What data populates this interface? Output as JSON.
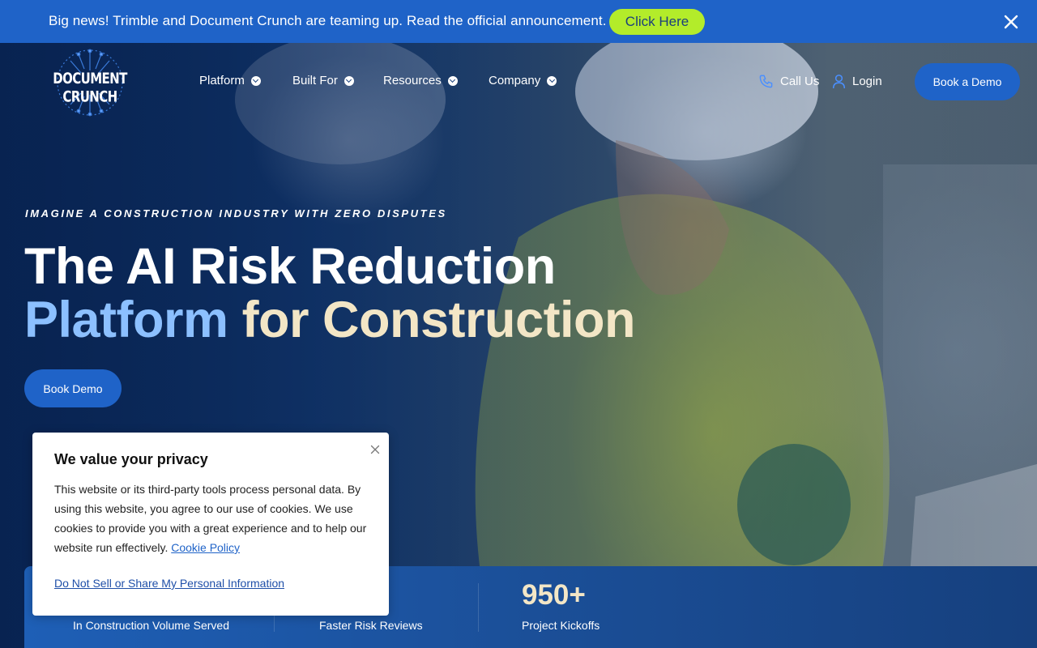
{
  "announcement": {
    "text": "Big news! Trimble and Document Crunch are teaming up. Read the official announcement.",
    "button_label": "Click Here",
    "button_color": "#b3ec2a",
    "close_icon": "close-icon"
  },
  "brand": {
    "name": "DOCUMENT CRUNCH",
    "logo_icon": "circuit-tree-logo"
  },
  "nav": {
    "items": [
      {
        "label": "Platform"
      },
      {
        "label": "Built For"
      },
      {
        "label": "Resources"
      },
      {
        "label": "Company"
      }
    ],
    "call_label": "Call Us",
    "login_label": "Login",
    "demo_label": "Book a Demo"
  },
  "hero": {
    "eyebrow": "IMAGINE A CONSTRUCTION INDUSTRY WITH ZERO DISPUTES",
    "headline_line1": "The AI Risk Reduction",
    "headline_blue": "Platform",
    "headline_cream": "for Construction",
    "cta_label": "Book Demo"
  },
  "stats": [
    {
      "value": "",
      "label": "In Construction Volume Served"
    },
    {
      "value": "",
      "label": "Faster Risk Reviews"
    },
    {
      "value": "950+",
      "label": "Project Kickoffs"
    }
  ],
  "cookie": {
    "title": "We value your privacy",
    "body": "This website or its third-party tools process personal data. By using this website, you agree to our use of cookies. We use cookies to provide you with a great experience and to help our website run effectively.",
    "policy_link": "Cookie Policy",
    "dns_link": "Do Not Sell or Share My Personal Information"
  },
  "colors": {
    "accent_blue": "#1f63c8",
    "headline_blue": "#8cc0ff",
    "headline_cream": "#f3e6c6"
  }
}
